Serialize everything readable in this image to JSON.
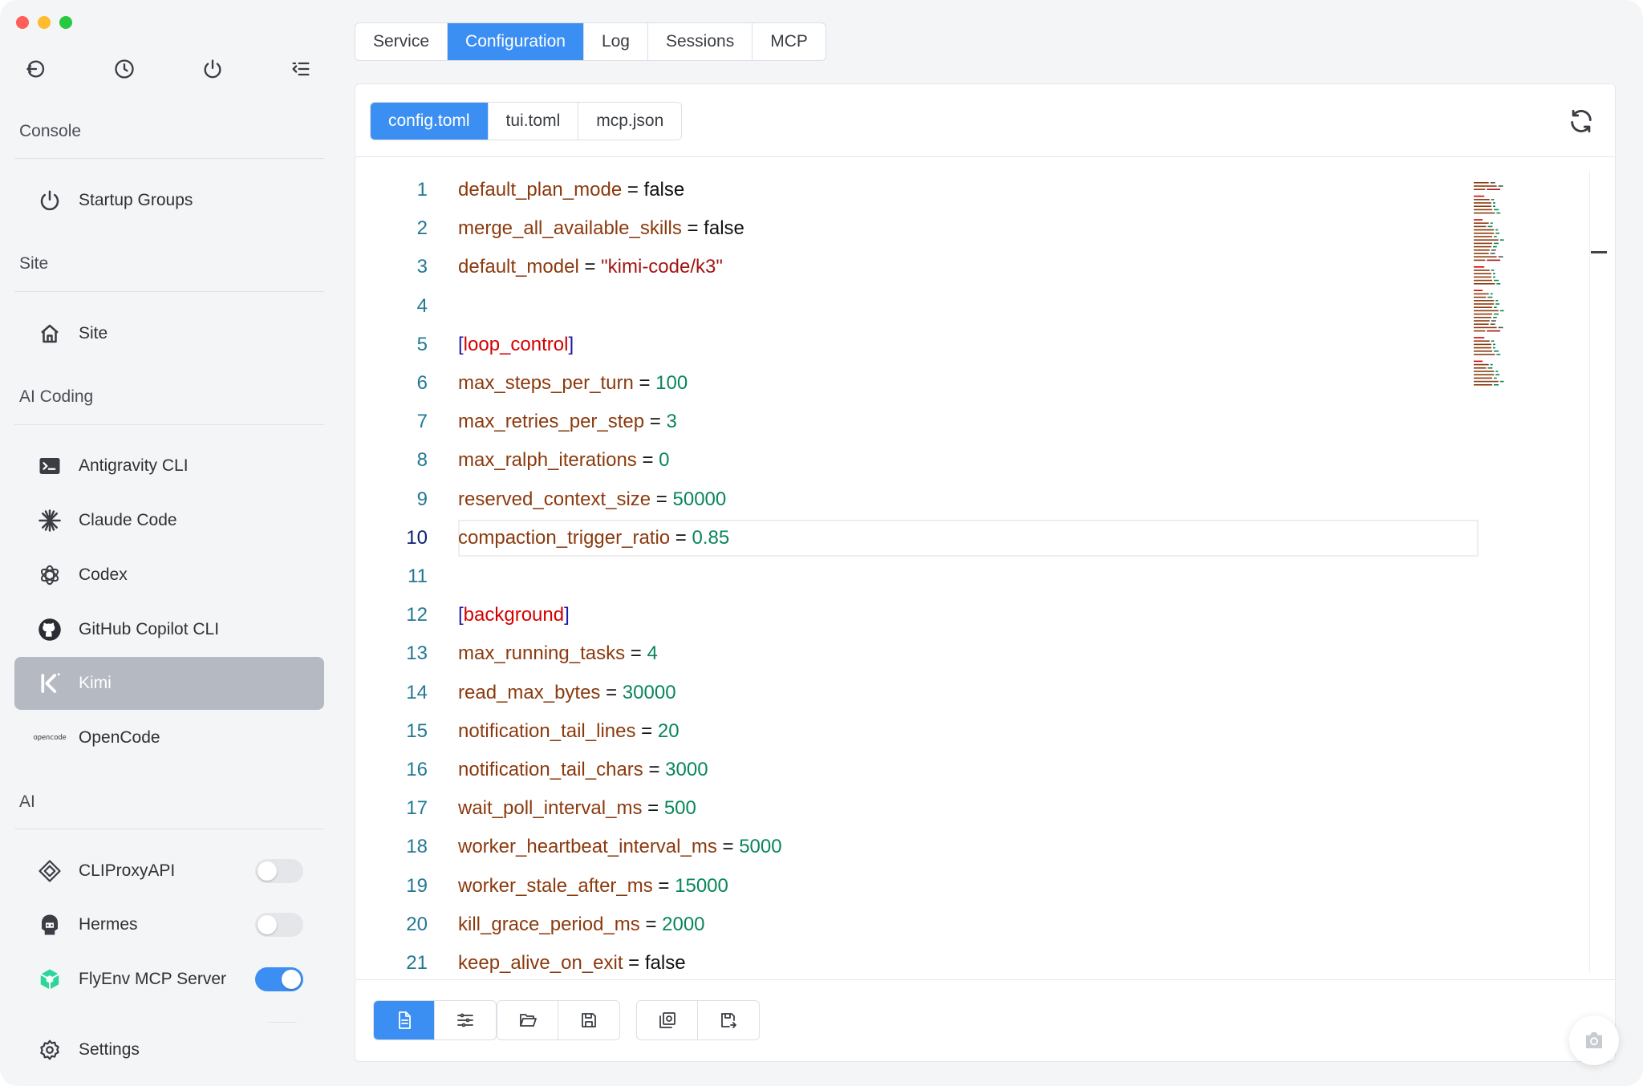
{
  "sidebar": {
    "sections": {
      "console": "Console",
      "site": "Site",
      "ai_coding": "AI Coding",
      "ai": "AI"
    },
    "items": {
      "startup_groups": "Startup Groups",
      "site": "Site",
      "antigravity": "Antigravity CLI",
      "claude": "Claude Code",
      "codex": "Codex",
      "copilot": "GitHub Copilot CLI",
      "kimi": "Kimi",
      "opencode": "OpenCode",
      "opencode_logo": "opencode",
      "cliproxy": "CLIProxyAPI",
      "hermes": "Hermes",
      "flyenv_mcp": "FlyEnv MCP Server",
      "settings": "Settings"
    },
    "toggles": {
      "cliproxy": false,
      "hermes": false,
      "flyenv_mcp": true
    },
    "active_item": "Kimi"
  },
  "top_tabs": [
    "Service",
    "Configuration",
    "Log",
    "Sessions",
    "MCP"
  ],
  "top_tabs_active": "Configuration",
  "file_tabs": [
    "config.toml",
    "tui.toml",
    "mcp.json"
  ],
  "file_tabs_active": "config.toml",
  "editor": {
    "current_line": 10,
    "lines": [
      {
        "n": "1",
        "k": "default_plan_mode",
        "v": "false",
        "t": "kw"
      },
      {
        "n": "2",
        "k": "merge_all_available_skills",
        "v": "false",
        "t": "kw"
      },
      {
        "n": "3",
        "k": "default_model",
        "v": "\"kimi-code/k3\"",
        "t": "str"
      },
      {
        "n": "4",
        "k": "",
        "v": "",
        "t": "blank"
      },
      {
        "n": "5",
        "k": "loop_control",
        "v": "",
        "t": "section"
      },
      {
        "n": "6",
        "k": "max_steps_per_turn",
        "v": "100",
        "t": "num"
      },
      {
        "n": "7",
        "k": "max_retries_per_step",
        "v": "3",
        "t": "num"
      },
      {
        "n": "8",
        "k": "max_ralph_iterations",
        "v": "0",
        "t": "num"
      },
      {
        "n": "9",
        "k": "reserved_context_size",
        "v": "50000",
        "t": "num"
      },
      {
        "n": "10",
        "k": "compaction_trigger_ratio",
        "v": "0.85",
        "t": "num"
      },
      {
        "n": "11",
        "k": "",
        "v": "",
        "t": "blank"
      },
      {
        "n": "12",
        "k": "background",
        "v": "",
        "t": "section"
      },
      {
        "n": "13",
        "k": "max_running_tasks",
        "v": "4",
        "t": "num"
      },
      {
        "n": "14",
        "k": "read_max_bytes",
        "v": "30000",
        "t": "num"
      },
      {
        "n": "15",
        "k": "notification_tail_lines",
        "v": "20",
        "t": "num"
      },
      {
        "n": "16",
        "k": "notification_tail_chars",
        "v": "3000",
        "t": "num"
      },
      {
        "n": "17",
        "k": "wait_poll_interval_ms",
        "v": "500",
        "t": "num"
      },
      {
        "n": "18",
        "k": "worker_heartbeat_interval_ms",
        "v": "5000",
        "t": "num"
      },
      {
        "n": "19",
        "k": "worker_stale_after_ms",
        "v": "15000",
        "t": "num"
      },
      {
        "n": "20",
        "k": "kill_grace_period_ms",
        "v": "2000",
        "t": "num"
      },
      {
        "n": "21",
        "k": "keep_alive_on_exit",
        "v": "false",
        "t": "kw"
      }
    ]
  },
  "toolbar_icons": [
    "document-icon",
    "sliders-icon",
    "folder-open-icon",
    "save-icon",
    "load-default-icon",
    "save-as-icon"
  ],
  "colors": {
    "accent": "#3b8ff3",
    "sidebar_active": "#b4b9c2",
    "key": "#8b3a0e",
    "number": "#098658",
    "string": "#a31515",
    "section": "#d40000",
    "bracket": "#1a1aa6",
    "line_number": "#237893"
  }
}
